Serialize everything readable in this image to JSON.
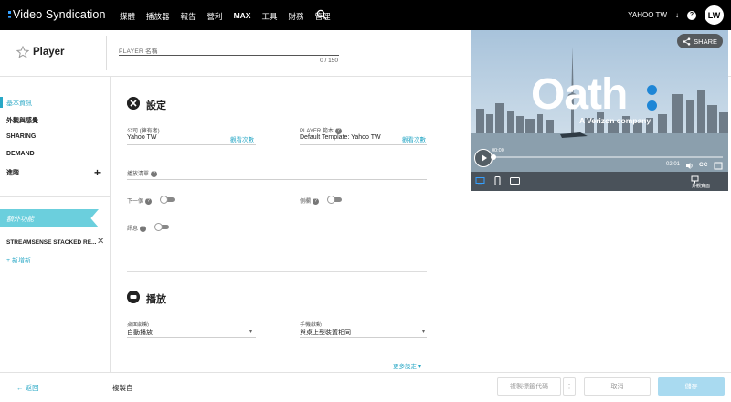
{
  "app": {
    "brand": "Video Syndication",
    "nav": [
      "媒體",
      "播放器",
      "報告",
      "營利",
      "MAX",
      "工具",
      "財務",
      "管理"
    ],
    "account": "YAHOO TW",
    "account_caret": "↓",
    "help": "?",
    "avatar_initials": "LW"
  },
  "header": {
    "title": "Player",
    "player_name_label": "PLAYER 名稱",
    "player_name_value": "",
    "char_count": "0 / 150"
  },
  "sidebar": {
    "items": [
      {
        "label": "基本資訊",
        "active": true
      },
      {
        "label": "外觀與感覺",
        "active": false
      },
      {
        "label": "SHARING",
        "active": false
      },
      {
        "label": "DEMAND",
        "active": false
      },
      {
        "label": "進階",
        "active": false
      }
    ],
    "expand_symbol": "+",
    "addons_label": "額外功能",
    "addon_item": "STREAMSENSE STACKED RE...",
    "addon_remove": "✕",
    "add_new": "+ 新增新"
  },
  "settings": {
    "title": "設定",
    "company_label": "公司 (擁有者)",
    "company_value": "Yahoo TW",
    "company_link": "觀看次數",
    "template_label": "PLAYER 範本",
    "template_value": "Default Template: Yahoo TW",
    "template_link": "觀看次數",
    "playlist_label": "播放清單",
    "next_label": "下一個",
    "sidebar_label": "側欄",
    "mute_label": "訊息",
    "help": "?"
  },
  "playback": {
    "title": "播放",
    "desktop_label": "桌面啟動",
    "desktop_value": "自動播放",
    "mobile_label": "手機啟動",
    "mobile_value": "與桌上型裝置相同",
    "more_settings": "更多設定",
    "caret": "▾"
  },
  "preview": {
    "logo_text": "Oath",
    "tagline": "A Verizon company",
    "share_label": "SHARE",
    "time_elapsed": "00:00",
    "duration": "02:01",
    "cc": "CC",
    "external_label": "外觀寬面"
  },
  "footer": {
    "back": "← 返回",
    "copy_from": "複製自",
    "copy_embed": "複製標籤代碼",
    "more": "⋮",
    "cancel": "取消",
    "save": "儲存"
  },
  "colors": {
    "accent": "#29a8c6",
    "ribbon": "#6bcfdd",
    "save_button": "#a9daf0",
    "topbar": "#000000"
  }
}
